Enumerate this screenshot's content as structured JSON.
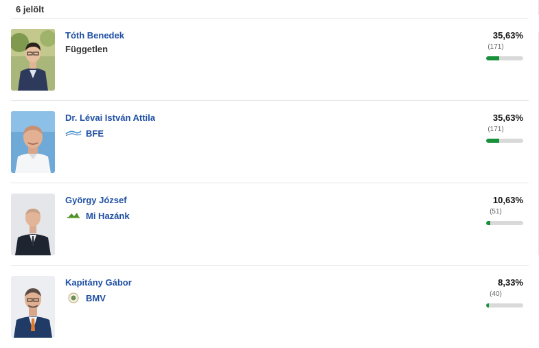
{
  "header": {
    "count_label": "6 jelölt"
  },
  "candidates": [
    {
      "name": "Tóth Benedek",
      "party": "Független",
      "party_logo": "none",
      "percent_label": "35,63%",
      "votes_label": "(171)",
      "share": 0.3563
    },
    {
      "name": "Dr. Lévai István Attila",
      "party": "BFE",
      "party_logo": "bfe-logo",
      "percent_label": "35,63%",
      "votes_label": "(171)",
      "share": 0.3563
    },
    {
      "name": "György József",
      "party": "Mi Hazánk",
      "party_logo": "mi-hazank-logo",
      "percent_label": "10,63%",
      "votes_label": "(51)",
      "share": 0.1063
    },
    {
      "name": "Kapitány Gábor",
      "party": "BMV",
      "party_logo": "bmv-logo",
      "percent_label": "8,33%",
      "votes_label": "(40)",
      "share": 0.0833
    }
  ],
  "colors": {
    "accent": "#1f4fa3",
    "bar_fill": "#17923a",
    "bar_track": "#d9d9d9",
    "divider": "#e6e6e6"
  }
}
